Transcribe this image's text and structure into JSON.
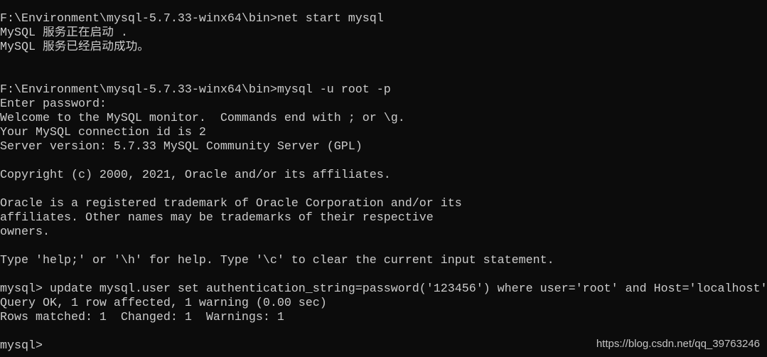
{
  "terminal": {
    "lines": [
      "F:\\Environment\\mysql-5.7.33-winx64\\bin>net start mysql",
      "MySQL 服务正在启动 .",
      "MySQL 服务已经启动成功。",
      "",
      "",
      "F:\\Environment\\mysql-5.7.33-winx64\\bin>mysql -u root -p",
      "Enter password:",
      "Welcome to the MySQL monitor.  Commands end with ; or \\g.",
      "Your MySQL connection id is 2",
      "Server version: 5.7.33 MySQL Community Server (GPL)",
      "",
      "Copyright (c) 2000, 2021, Oracle and/or its affiliates.",
      "",
      "Oracle is a registered trademark of Oracle Corporation and/or its",
      "affiliates. Other names may be trademarks of their respective",
      "owners.",
      "",
      "Type 'help;' or '\\h' for help. Type '\\c' to clear the current input statement.",
      "",
      "mysql> update mysql.user set authentication_string=password('123456') where user='root' and Host='localhost'",
      "Query OK, 1 row affected, 1 warning (0.00 sec)",
      "Rows matched: 1  Changed: 1  Warnings: 1",
      "",
      "mysql>"
    ]
  },
  "watermark": "https://blog.csdn.net/qq_39763246",
  "colors": {
    "background": "#0c0c0c",
    "text": "#cccccc"
  }
}
